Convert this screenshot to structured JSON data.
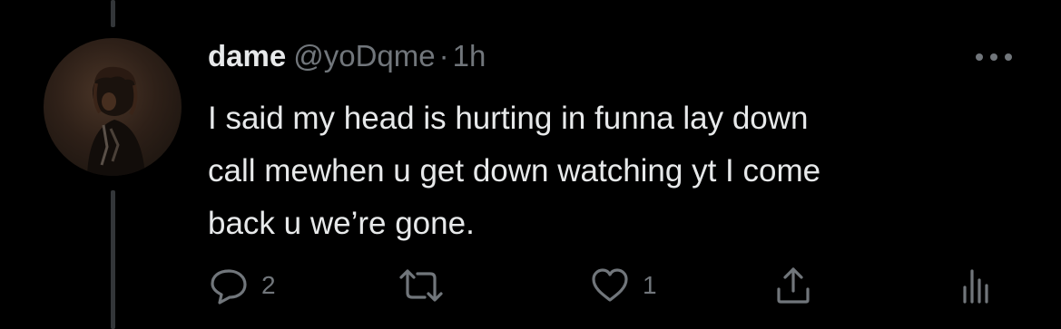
{
  "tweet": {
    "display_name": "dame",
    "handle": "@yoDqme",
    "separator": "·",
    "time": "1h",
    "text": "I said my head is hurting in funna lay down\ncall mewhen u get down watching yt I come\nback u we’re gone."
  },
  "actions": {
    "reply_count": "2",
    "retweet_count": "",
    "like_count": "1"
  },
  "icons": {
    "more": "more-horizontal-icon",
    "reply": "reply-bubble-icon",
    "retweet": "retweet-arrows-icon",
    "like": "heart-icon",
    "share": "share-upload-icon",
    "analytics": "analytics-bars-icon"
  },
  "colors": {
    "background": "#000000",
    "primary_text": "#e7e9ea",
    "secondary_text": "#71767b",
    "thread_line": "#333639"
  }
}
